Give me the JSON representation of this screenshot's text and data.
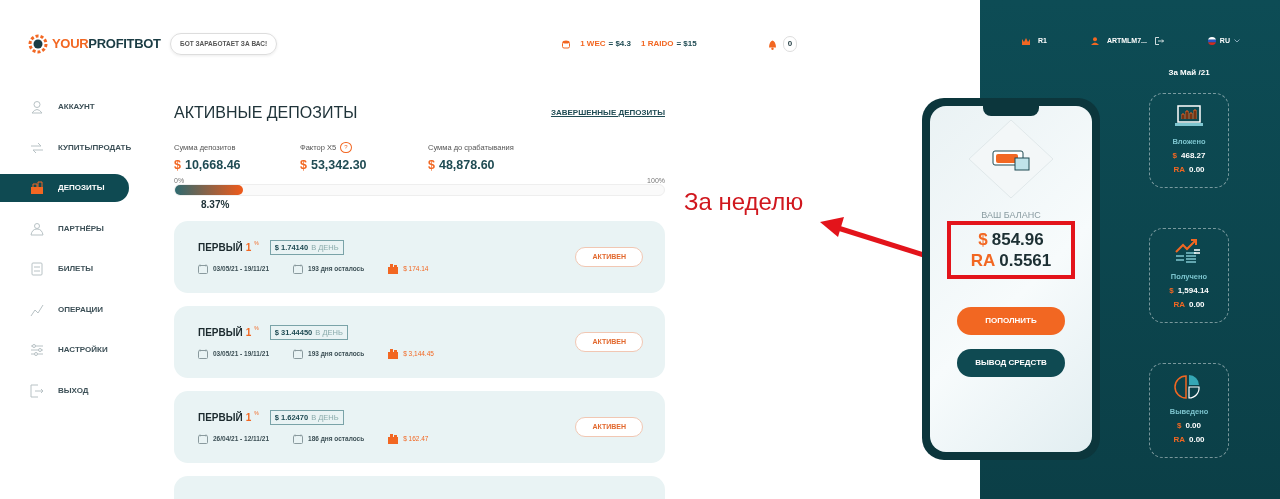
{
  "logo": {
    "part_a": "YOUR",
    "part_b": "PROFITBOT"
  },
  "slogan": "БОТ ЗАРАБОТАЕТ ЗА ВАС!",
  "rates": [
    {
      "unit": "1 WEC",
      "value": "= $4.3"
    },
    {
      "unit": "1 RAIDO",
      "value": "= $15"
    }
  ],
  "notifications": {
    "count": "0"
  },
  "sidebar": {
    "items": [
      {
        "label": "АККАУНТ",
        "kind": "user",
        "selected": false
      },
      {
        "label": "КУПИТЬ/ПРОДАТЬ",
        "kind": "exchange",
        "selected": false
      },
      {
        "label": "ДЕПОЗИТЫ",
        "kind": "deposit",
        "selected": true
      },
      {
        "label": "ПАРТНЁРЫ",
        "kind": "partners",
        "selected": false
      },
      {
        "label": "БИЛЕТЫ",
        "kind": "ticket",
        "selected": false
      },
      {
        "label": "ОПЕРАЦИИ",
        "kind": "chart",
        "selected": false
      },
      {
        "label": "НАСТРОЙКИ",
        "kind": "settings",
        "selected": false
      },
      {
        "label": "ВЫХОД",
        "kind": "logout",
        "selected": false
      }
    ]
  },
  "page": {
    "title": "АКТИВНЫЕ ДЕПОЗИТЫ",
    "link": "ЗАВЕРШЕННЫЕ ДЕПОЗИТЫ"
  },
  "summary": [
    {
      "label": "Сумма депозитов",
      "currency": "$",
      "amount": "10,668.46"
    },
    {
      "label": "Фактор X5",
      "help": "?",
      "currency": "$",
      "amount": "53,342.30"
    },
    {
      "label": "Сумма до срабатывания",
      "currency": "$",
      "amount": "48,878.60"
    }
  ],
  "progress": {
    "min_label": "0%",
    "max_label": "100%",
    "level": 0.14,
    "reading": "8.37%"
  },
  "deposits": [
    {
      "name": "ПЕРВЫЙ",
      "rate": "1",
      "rate_unit": "%",
      "daily": "$ 1.74140",
      "daily_suffix": "В ДЕНЬ",
      "dates": "03/05/21 - 19/11/21",
      "remaining": "193 дня осталось",
      "earned": "$ 174.14",
      "status": "АКТИВЕН"
    },
    {
      "name": "ПЕРВЫЙ",
      "rate": "1",
      "rate_unit": "%",
      "daily": "$ 31.44450",
      "daily_suffix": "В ДЕНЬ",
      "dates": "03/05/21 - 19/11/21",
      "remaining": "193 дня осталось",
      "earned": "$ 3,144.45",
      "status": "АКТИВЕН"
    },
    {
      "name": "ПЕРВЫЙ",
      "rate": "1",
      "rate_unit": "%",
      "daily": "$ 1.62470",
      "daily_suffix": "В ДЕНЬ",
      "dates": "26/04/21 - 12/11/21",
      "remaining": "186 дня осталось",
      "earned": "$ 162.47",
      "status": "АКТИВЕН"
    }
  ],
  "more_below": true,
  "annotation": {
    "text": "За неделю"
  },
  "phone": {
    "balance_label": "ВАШ БАЛАНС",
    "usd_symbol": "$",
    "usd": "854.96",
    "ra_symbol": "RA",
    "ra": "0.5561",
    "buttons": [
      {
        "label": "ПОПОЛНИТЬ",
        "kind": "primary"
      },
      {
        "label": "ВЫВОД СРЕДСТВ",
        "kind": "secondary"
      }
    ]
  },
  "panel": {
    "rank": "R1",
    "user": "ARTMLM7...",
    "language": "RU",
    "period": "За Май /21",
    "stats": [
      {
        "kind": "laptop",
        "label": "Вложено",
        "usd_symbol": "$",
        "usd": "468.27",
        "ra_symbol": "RA",
        "ra": "0.00"
      },
      {
        "kind": "growth",
        "label": "Получено",
        "usd_symbol": "$",
        "usd": "1,594.14",
        "ra_symbol": "RA",
        "ra": "0.00"
      },
      {
        "kind": "pie",
        "label": "Выведено",
        "usd_symbol": "$",
        "usd": "0.00",
        "ra_symbol": "RA",
        "ra": "0.00"
      }
    ]
  }
}
